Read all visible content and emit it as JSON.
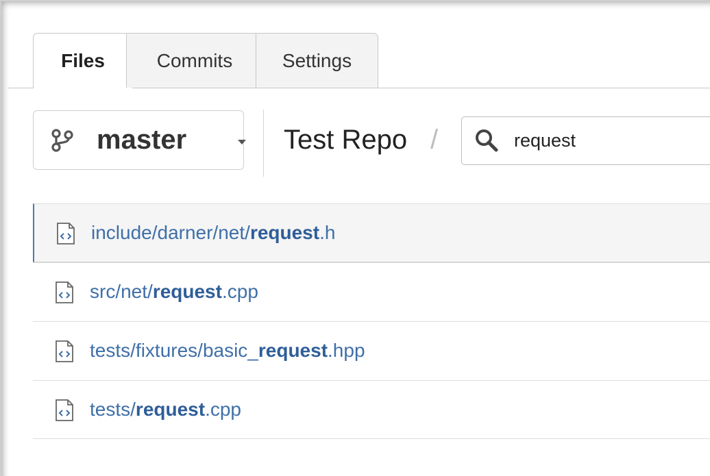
{
  "tabs": [
    {
      "label": "Files",
      "active": true
    },
    {
      "label": "Commits",
      "active": false
    },
    {
      "label": "Settings",
      "active": false
    }
  ],
  "branch": {
    "name": "master",
    "icon": "branch-icon"
  },
  "repo": {
    "name": "Test Repo",
    "separator": "/"
  },
  "search": {
    "value": "request",
    "icon": "search-icon"
  },
  "files": [
    {
      "prefix": "include/darner/net/",
      "match": "request",
      "suffix": ".h",
      "selected": true
    },
    {
      "prefix": "src/net/",
      "match": "request",
      "suffix": ".cpp",
      "selected": false
    },
    {
      "prefix": "tests/fixtures/basic_",
      "match": "request",
      "suffix": ".hpp",
      "selected": false
    },
    {
      "prefix": "tests/",
      "match": "request",
      "suffix": ".cpp",
      "selected": false
    }
  ],
  "colors": {
    "link": "#3f6fa8",
    "selected_border": "#4a78b4"
  }
}
